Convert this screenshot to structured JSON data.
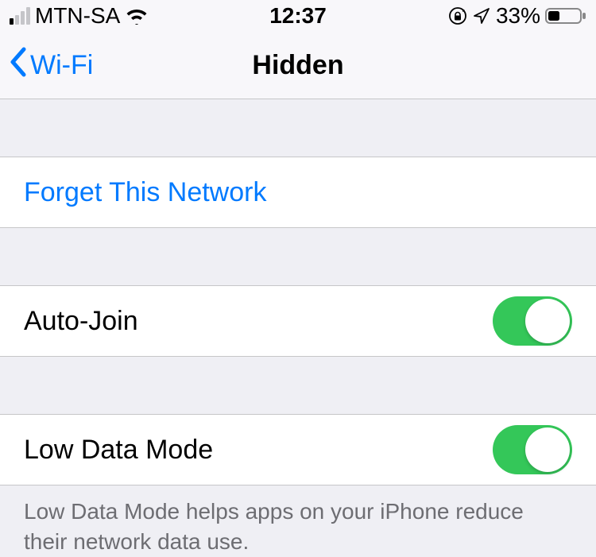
{
  "status": {
    "carrier": "MTN-SA",
    "time": "12:37",
    "battery_percent": "33%"
  },
  "nav": {
    "back_label": "Wi-Fi",
    "title": "Hidden"
  },
  "cells": {
    "forget": "Forget This Network",
    "autojoin_label": "Auto-Join",
    "lowdata_label": "Low Data Mode"
  },
  "footer": {
    "lowdata": "Low Data Mode helps apps on your iPhone reduce their network data use."
  },
  "toggles": {
    "autojoin_on": true,
    "lowdata_on": true
  }
}
